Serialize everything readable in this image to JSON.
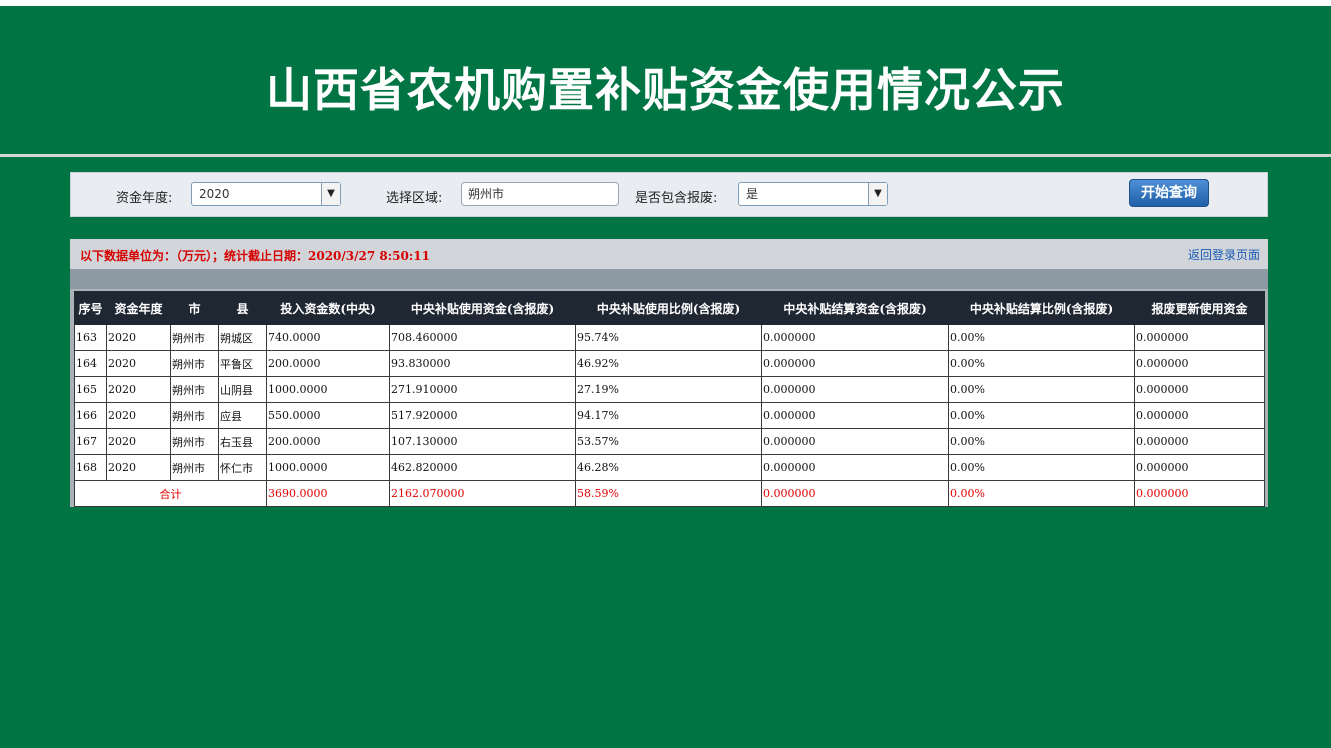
{
  "page": {
    "title": "山西省农机购置补贴资金使用情况公示"
  },
  "filters": {
    "year_label": "资金年度:",
    "year_value": "2020",
    "region_label": "选择区域:",
    "region_value": "朔州市",
    "include_label": "是否包含报废:",
    "include_value": "是",
    "query_button": "开始查询"
  },
  "info": {
    "text": "以下数据单位为：（万元）；统计截止日期：2020/3/27 8:50:11",
    "back_link": "返回登录页面"
  },
  "table": {
    "headers": [
      "序号",
      "资金年度",
      "市",
      "县",
      "投入资金数(中央)",
      "中央补贴使用资金(含报废)",
      "中央补贴使用比例(含报废)",
      "中央补贴结算资金(含报废)",
      "中央补贴结算比例(含报废)",
      "报废更新使用资金"
    ],
    "rows": [
      [
        "163",
        "2020",
        "朔州市",
        "朔城区",
        "740.0000",
        "708.460000",
        "95.74%",
        "0.000000",
        "0.00%",
        "0.000000"
      ],
      [
        "164",
        "2020",
        "朔州市",
        "平鲁区",
        "200.0000",
        "93.830000",
        "46.92%",
        "0.000000",
        "0.00%",
        "0.000000"
      ],
      [
        "165",
        "2020",
        "朔州市",
        "山阴县",
        "1000.0000",
        "271.910000",
        "27.19%",
        "0.000000",
        "0.00%",
        "0.000000"
      ],
      [
        "166",
        "2020",
        "朔州市",
        "应县",
        "550.0000",
        "517.920000",
        "94.17%",
        "0.000000",
        "0.00%",
        "0.000000"
      ],
      [
        "167",
        "2020",
        "朔州市",
        "右玉县",
        "200.0000",
        "107.130000",
        "53.57%",
        "0.000000",
        "0.00%",
        "0.000000"
      ],
      [
        "168",
        "2020",
        "朔州市",
        "怀仁市",
        "1000.0000",
        "462.820000",
        "46.28%",
        "0.000000",
        "0.00%",
        "0.000000"
      ]
    ],
    "total": {
      "label": "合计",
      "values": [
        "3690.0000",
        "2162.070000",
        "58.59%",
        "0.000000",
        "0.00%",
        "0.000000"
      ]
    }
  },
  "colors": {
    "background": "#007543",
    "header_row": "#1f2733",
    "highlight_red": "#e60000",
    "button_blue": "#2f6fb8"
  }
}
